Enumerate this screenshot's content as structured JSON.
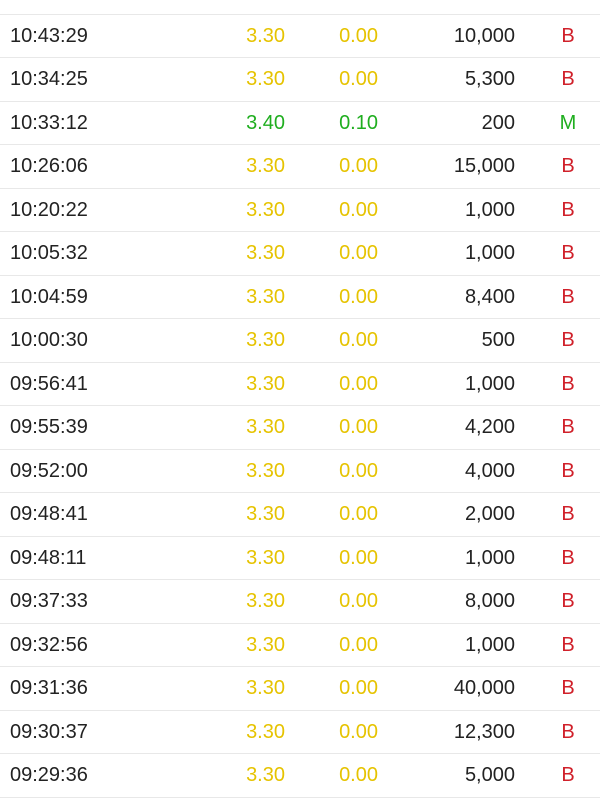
{
  "colors": {
    "neutral": "#e6c300",
    "up": "#1fae1f",
    "buy": "#d0202a",
    "mid": "#1fae1f",
    "text": "#222222",
    "divider": "#e8e8e8"
  },
  "trades": [
    {
      "time": "",
      "price": "",
      "change": "",
      "volume": "",
      "side": "",
      "tone": "neutral"
    },
    {
      "time": "10:43:29",
      "price": "3.30",
      "change": "0.00",
      "volume": "10,000",
      "side": "B",
      "tone": "neutral"
    },
    {
      "time": "10:34:25",
      "price": "3.30",
      "change": "0.00",
      "volume": "5,300",
      "side": "B",
      "tone": "neutral"
    },
    {
      "time": "10:33:12",
      "price": "3.40",
      "change": "0.10",
      "volume": "200",
      "side": "M",
      "tone": "up"
    },
    {
      "time": "10:26:06",
      "price": "3.30",
      "change": "0.00",
      "volume": "15,000",
      "side": "B",
      "tone": "neutral"
    },
    {
      "time": "10:20:22",
      "price": "3.30",
      "change": "0.00",
      "volume": "1,000",
      "side": "B",
      "tone": "neutral"
    },
    {
      "time": "10:05:32",
      "price": "3.30",
      "change": "0.00",
      "volume": "1,000",
      "side": "B",
      "tone": "neutral"
    },
    {
      "time": "10:04:59",
      "price": "3.30",
      "change": "0.00",
      "volume": "8,400",
      "side": "B",
      "tone": "neutral"
    },
    {
      "time": "10:00:30",
      "price": "3.30",
      "change": "0.00",
      "volume": "500",
      "side": "B",
      "tone": "neutral"
    },
    {
      "time": "09:56:41",
      "price": "3.30",
      "change": "0.00",
      "volume": "1,000",
      "side": "B",
      "tone": "neutral"
    },
    {
      "time": "09:55:39",
      "price": "3.30",
      "change": "0.00",
      "volume": "4,200",
      "side": "B",
      "tone": "neutral"
    },
    {
      "time": "09:52:00",
      "price": "3.30",
      "change": "0.00",
      "volume": "4,000",
      "side": "B",
      "tone": "neutral"
    },
    {
      "time": "09:48:41",
      "price": "3.30",
      "change": "0.00",
      "volume": "2,000",
      "side": "B",
      "tone": "neutral"
    },
    {
      "time": "09:48:11",
      "price": "3.30",
      "change": "0.00",
      "volume": "1,000",
      "side": "B",
      "tone": "neutral"
    },
    {
      "time": "09:37:33",
      "price": "3.30",
      "change": "0.00",
      "volume": "8,000",
      "side": "B",
      "tone": "neutral"
    },
    {
      "time": "09:32:56",
      "price": "3.30",
      "change": "0.00",
      "volume": "1,000",
      "side": "B",
      "tone": "neutral"
    },
    {
      "time": "09:31:36",
      "price": "3.30",
      "change": "0.00",
      "volume": "40,000",
      "side": "B",
      "tone": "neutral"
    },
    {
      "time": "09:30:37",
      "price": "3.30",
      "change": "0.00",
      "volume": "12,300",
      "side": "B",
      "tone": "neutral"
    },
    {
      "time": "09:29:36",
      "price": "3.30",
      "change": "0.00",
      "volume": "5,000",
      "side": "B",
      "tone": "neutral"
    }
  ]
}
